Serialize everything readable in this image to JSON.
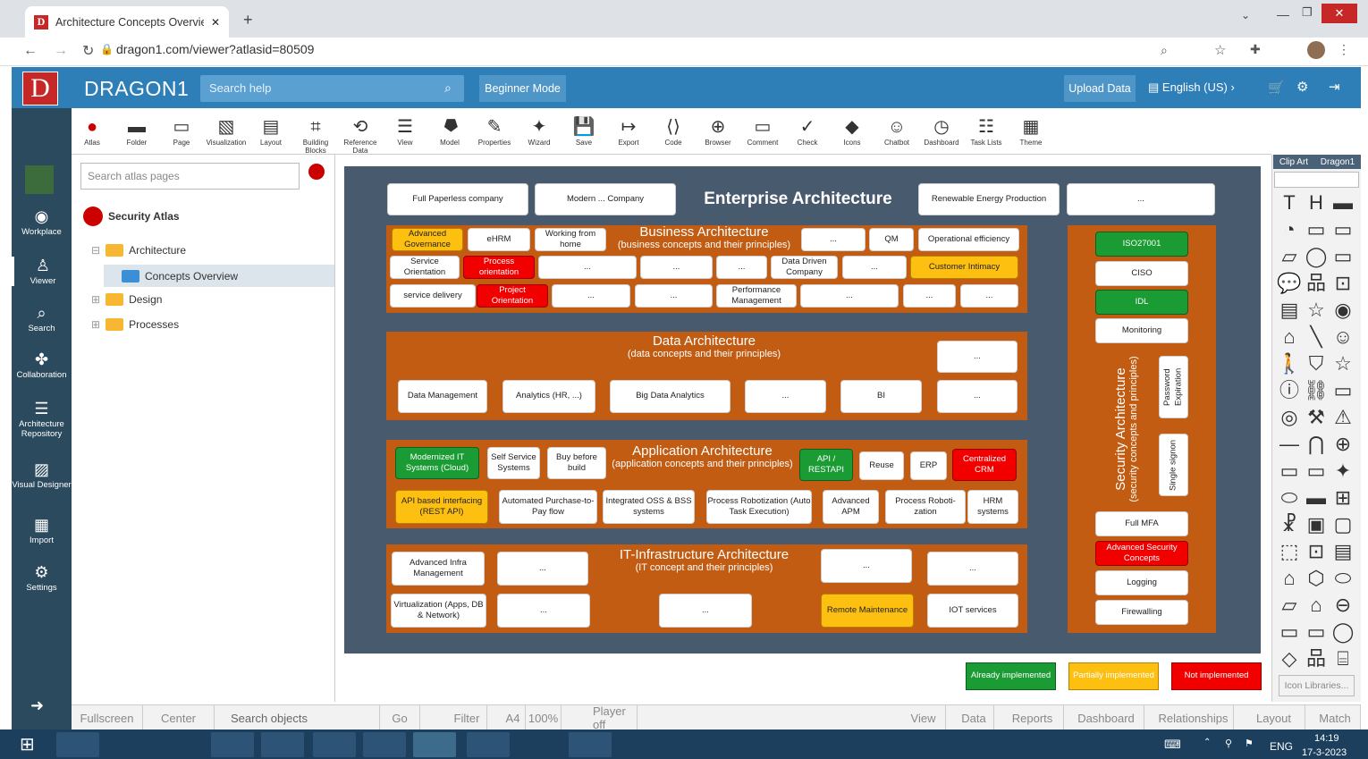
{
  "browser": {
    "tab_title": "Architecture Concepts Overview",
    "url": "dragon1.com/viewer?atlasid=80509"
  },
  "header": {
    "logo": "D",
    "title": "DRAGON1",
    "search_placeholder": "Search help",
    "beginner": "Beginner Mode",
    "upload": "Upload Data",
    "language": "English (US)"
  },
  "toolbar": [
    "Atlas",
    "Folder",
    "Page",
    "Visualization",
    "Layout",
    "Building Blocks",
    "Reference Data",
    "View",
    "Model",
    "Properties",
    "Wizard",
    "Save",
    "Export",
    "Code",
    "Browser",
    "Comment",
    "Check",
    "Icons",
    "Chatbot",
    "Dashboard",
    "Task Lists",
    "Theme"
  ],
  "sidebar": [
    "Workplace",
    "Viewer",
    "Search",
    "Collaboration",
    "Architecture Repository",
    "Visual Designer",
    "Import",
    "Settings"
  ],
  "tree": {
    "search_placeholder": "Search atlas pages",
    "atlas": "Security Atlas",
    "nodes": [
      "Architecture",
      "Concepts Overview",
      "Design",
      "Processes"
    ]
  },
  "diagram": {
    "top": [
      "Full Paperless company",
      "Modern ... Company",
      "Enterprise Architecture",
      "Renewable Energy Production",
      "..."
    ],
    "business": {
      "title": "Business Architecture",
      "subtitle": "(business concepts and their principles)"
    },
    "data": {
      "title": "Data Architecture",
      "subtitle": "(data concepts and their principles)"
    },
    "application": {
      "title": "Application Architecture",
      "subtitle": "(application concepts and their principles)"
    },
    "infra": {
      "title": "IT-Infrastructure Architecture",
      "subtitle": "(IT concept and their principles)"
    },
    "security": {
      "title": "Security Architecture",
      "subtitle": "(security concepts and principles)"
    },
    "b": [
      "Advanced Governance",
      "eHRM",
      "Working from home",
      "...",
      "QM",
      "Operational efficiency",
      "Service Orientation",
      "Process orientation",
      "...",
      "...",
      "...",
      "Data Driven Company",
      "...",
      "Customer Intimacy",
      "service delivery",
      "Project Orientation",
      "...",
      "...",
      "Performance Management",
      "...",
      "...",
      "..."
    ],
    "d": [
      "...",
      "Data Management",
      "Analytics (HR, ...)",
      "Big Data Analytics",
      "...",
      "BI",
      "..."
    ],
    "a": [
      "Modernized IT Systems (Cloud)",
      "Self Service Systems",
      "Buy before build",
      "API / RESTAPI",
      "Reuse",
      "ERP",
      "Centralized CRM",
      "API based interfacing (REST API)",
      "Automated Purchase-to-Pay flow",
      "Integrated OSS & BSS systems",
      "Process Robotization (Auto Task Execution)",
      "Advanced APM",
      "Process Roboti-zation",
      "HRM systems"
    ],
    "i": [
      "Advanced Infra Management",
      "...",
      "...",
      "...",
      "Virtualization (Apps, DB & Network)",
      "...",
      "...",
      "Remote Maintenance",
      "IOT services"
    ],
    "s": [
      "ISO27001",
      "CISO",
      "IDL",
      "Monitoring",
      "Password Expiration",
      "Single signon",
      "Full MFA",
      "Advanced Security Concepts",
      "Logging",
      "Firewalling"
    ]
  },
  "legend": [
    "Already implemented",
    "Partially implemented",
    "Not implemented"
  ],
  "rightpanel": {
    "tabs": [
      "Clip Art",
      "Dragon1"
    ],
    "icon_lib": "Icon Libraries..."
  },
  "bottom": [
    "Fullscreen",
    "Center",
    "Search objects",
    "Go",
    "Filter",
    "A4",
    "100%",
    "Player off",
    "View",
    "Data",
    "Reports",
    "Dashboard",
    "Relationships",
    "Layout",
    "Match"
  ],
  "taskbar": {
    "lang": "ENG",
    "time": "14:19",
    "date": "17-3-2023"
  },
  "colors": {
    "orange": "#c15c12",
    "green": "#1a9b34",
    "yellow": "#fdbf10",
    "red": "#f20000"
  }
}
